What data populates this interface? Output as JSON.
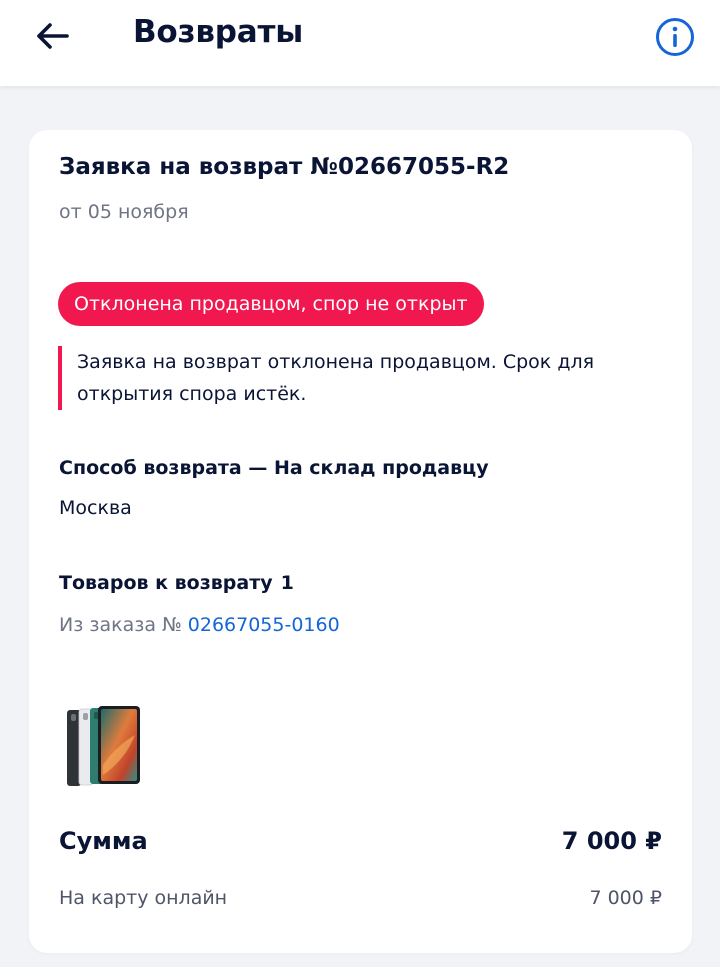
{
  "header": {
    "title": "Возвраты",
    "back_icon": "arrow-left-icon",
    "info_icon": "info-circle-icon"
  },
  "request": {
    "title": "Заявка на возврат №02667055-R2",
    "date": "от 05 ноября",
    "status_badge": "Отклонена продавцом, спор не открыт",
    "notice": "Заявка на возврат отклонена продавцом. Срок для открытия спора истёк.",
    "method_title": "Способ возврата — На склад продавцу",
    "city": "Москва",
    "items_label": "Товаров к возврату",
    "items_count": "1",
    "order_prefix": "Из заказа №",
    "order_number": "02667055-0160",
    "sum_label": "Сумма",
    "sum_value": "7 000 ₽",
    "payment_label": "На карту онлайн",
    "payment_value": "7 000 ₽"
  },
  "colors": {
    "accent_red": "#f1174f",
    "link_blue": "#1466d6",
    "text_dark": "#0a1435",
    "text_muted": "#6f7486",
    "background": "#f2f3f7"
  }
}
